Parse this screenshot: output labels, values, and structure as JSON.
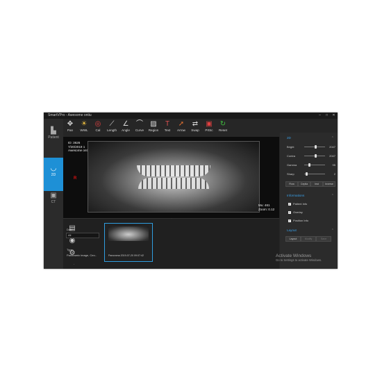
{
  "window": {
    "title": "SmartVPro - Awesome ontiu"
  },
  "toolbar": [
    {
      "label": "Pan",
      "icon": "move-icon",
      "glyph": "✥",
      "color": "#dddddd"
    },
    {
      "label": "WWL",
      "icon": "sun-icon",
      "glyph": "☀",
      "color": "#f0c040"
    },
    {
      "label": "Cal",
      "icon": "target-icon",
      "glyph": "◎",
      "color": "#e04040"
    },
    {
      "label": "Length",
      "icon": "ruler-icon",
      "glyph": "⟋",
      "color": "#dddddd"
    },
    {
      "label": "Angle",
      "icon": "angle-icon",
      "glyph": "∠",
      "color": "#dddddd"
    },
    {
      "label": "Curve",
      "icon": "curve-icon",
      "glyph": "⌒",
      "color": "#dddddd"
    },
    {
      "label": "Region",
      "icon": "region-icon",
      "glyph": "▨",
      "color": "#dddddd"
    },
    {
      "label": "Text",
      "icon": "text-icon",
      "glyph": "T",
      "color": "#e05050"
    },
    {
      "label": "Arrow",
      "icon": "arrow-icon",
      "glyph": "➚",
      "color": "#e07030"
    },
    {
      "label": "Swap",
      "icon": "swap-icon",
      "glyph": "⇄",
      "color": "#dddddd"
    },
    {
      "label": "PrtSc",
      "icon": "screenshot-icon",
      "glyph": "▣",
      "color": "#e04040"
    },
    {
      "label": "Reset",
      "icon": "reset-icon",
      "glyph": "↻",
      "color": "#40c040"
    }
  ],
  "sidebar": [
    {
      "label": "Patient",
      "icon": "patient-icon",
      "glyph": "▙",
      "active": false
    },
    {
      "label": "2D",
      "icon": "tooth-arc-icon",
      "glyph": "◡",
      "active": true
    },
    {
      "label": "CT",
      "icon": "ct-icon",
      "glyph": "▣",
      "active": false
    }
  ],
  "viewer": {
    "overlay_lines": [
      "ID: 3626",
      "7/20/2019 1",
      "Awesome onti"
    ],
    "orientation_mark": "R",
    "br_lines": [
      "Mu: 461",
      "Zoom: 0.12"
    ]
  },
  "panel_2d": {
    "title": "2D",
    "sliders": [
      {
        "label": "Bright",
        "value": "2047",
        "pos": 0.55
      },
      {
        "label": "Contra",
        "value": "2047",
        "pos": 0.55
      },
      {
        "label": "Gamma",
        "value": "95",
        "pos": 0.25
      },
      {
        "label": "Sharp",
        "value": "2",
        "pos": 0.1
      }
    ],
    "buttons": [
      "Flow",
      "Ceplia",
      "Inst",
      "Inverse"
    ]
  },
  "panel_info": {
    "title": "Informations",
    "checks": [
      {
        "label": "Patient Info",
        "checked": true
      },
      {
        "label": "Overlay",
        "checked": true
      },
      {
        "label": "Position Info",
        "checked": true
      }
    ]
  },
  "panel_layout": {
    "title": "Layout",
    "buttons": [
      "Layout",
      "Modify",
      "Save"
    ]
  },
  "bottom": {
    "date_label": "Date:",
    "date_value": "All",
    "type_label": "Type:",
    "type_value": "Panoramic image, Ceo..",
    "thumbnail_caption": "Panorama   2019-07-20 09:07:42"
  },
  "watermark": {
    "title": "Activate Windows",
    "subtitle": "Go to Settings to activate Windows."
  }
}
